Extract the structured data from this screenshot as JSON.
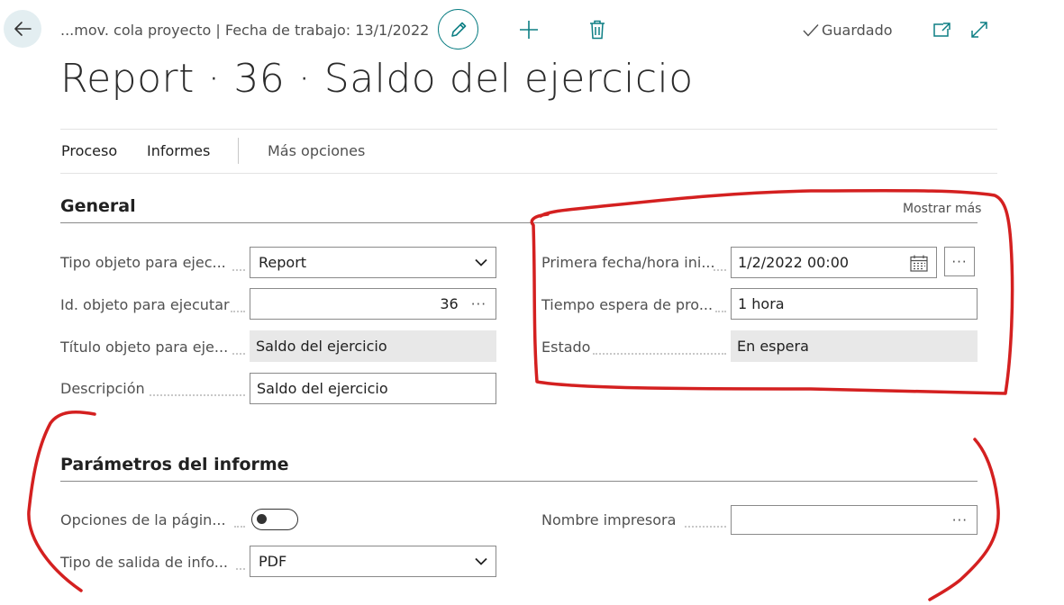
{
  "header": {
    "breadcrumb": "...mov. cola proyecto | Fecha de trabajo: 13/1/2022",
    "saved_label": "Guardado",
    "page_title": "Report · 36 · Saldo del ejercicio"
  },
  "actions": [
    {
      "label": "Proceso"
    },
    {
      "label": "Informes"
    },
    {
      "label": "Más opciones"
    }
  ],
  "general": {
    "title": "General",
    "show_more": "Mostrar más",
    "fields": {
      "object_type": {
        "label": "Tipo objeto para ejec...",
        "value": "Report"
      },
      "object_id": {
        "label": "Id. objeto para ejecutar",
        "value": "36",
        "ellipsis": "···"
      },
      "object_title": {
        "label": "Título objeto para eje...",
        "value": "Saldo del ejercicio"
      },
      "description": {
        "label": "Descripción",
        "value": "Saldo del ejercicio"
      },
      "first_start": {
        "label": "Primera fecha/hora ini...",
        "value": "1/2/2022 00:00",
        "ellipsis": "···"
      },
      "wait_time": {
        "label": "Tiempo espera de pro...",
        "value": "1 hora"
      },
      "status": {
        "label": "Estado",
        "value": "En espera"
      }
    }
  },
  "report_params": {
    "title": "Parámetros del informe",
    "fields": {
      "page_options": {
        "label": "Opciones de la págin...",
        "toggle_on": false
      },
      "output_type": {
        "label": "Tipo de salida de info...",
        "value": "PDF"
      },
      "printer_name": {
        "label": "Nombre impresora",
        "value": "",
        "ellipsis": "···"
      }
    }
  },
  "colors": {
    "accent": "#0d7f84",
    "annotation": "#d42020",
    "readonly_bg": "#e8e8e8"
  },
  "icons": [
    "back-arrow-icon",
    "pencil-icon",
    "plus-icon",
    "trash-icon",
    "checkmark-icon",
    "popout-icon",
    "expand-icon",
    "calendar-icon",
    "chevron-down-icon"
  ]
}
